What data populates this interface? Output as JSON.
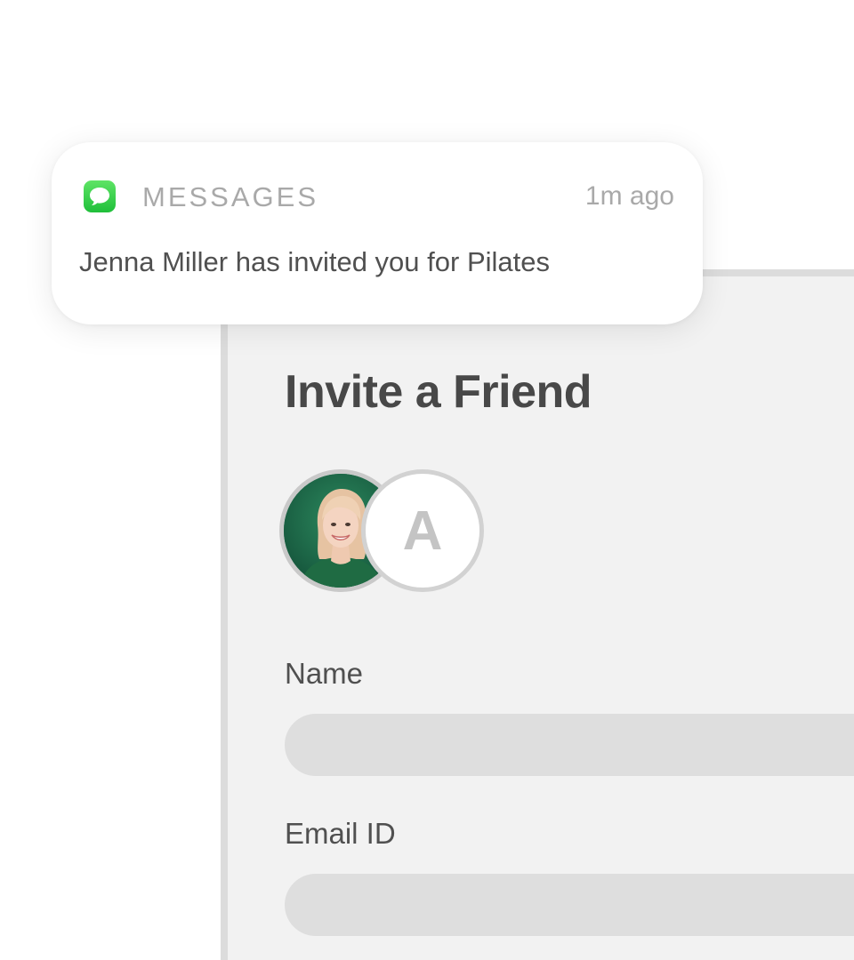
{
  "notification": {
    "app_icon": "messages-icon",
    "app_name": "MESSAGES",
    "time": "1m ago",
    "message": "Jenna Miller has invited you for Pilates"
  },
  "invite_form": {
    "title": "Invite a Friend",
    "avatars": [
      {
        "type": "photo",
        "icon": "user-photo"
      },
      {
        "type": "initial",
        "initial": "A"
      }
    ],
    "fields": [
      {
        "label": "Name",
        "value": "",
        "placeholder": ""
      },
      {
        "label": "Email ID",
        "value": "",
        "placeholder": ""
      }
    ]
  },
  "colors": {
    "app_icon_green": "#2fd04a",
    "card_background": "#f2f2f2",
    "input_background": "#dedede",
    "text_primary": "#484848",
    "text_muted": "#a9a9a9"
  }
}
